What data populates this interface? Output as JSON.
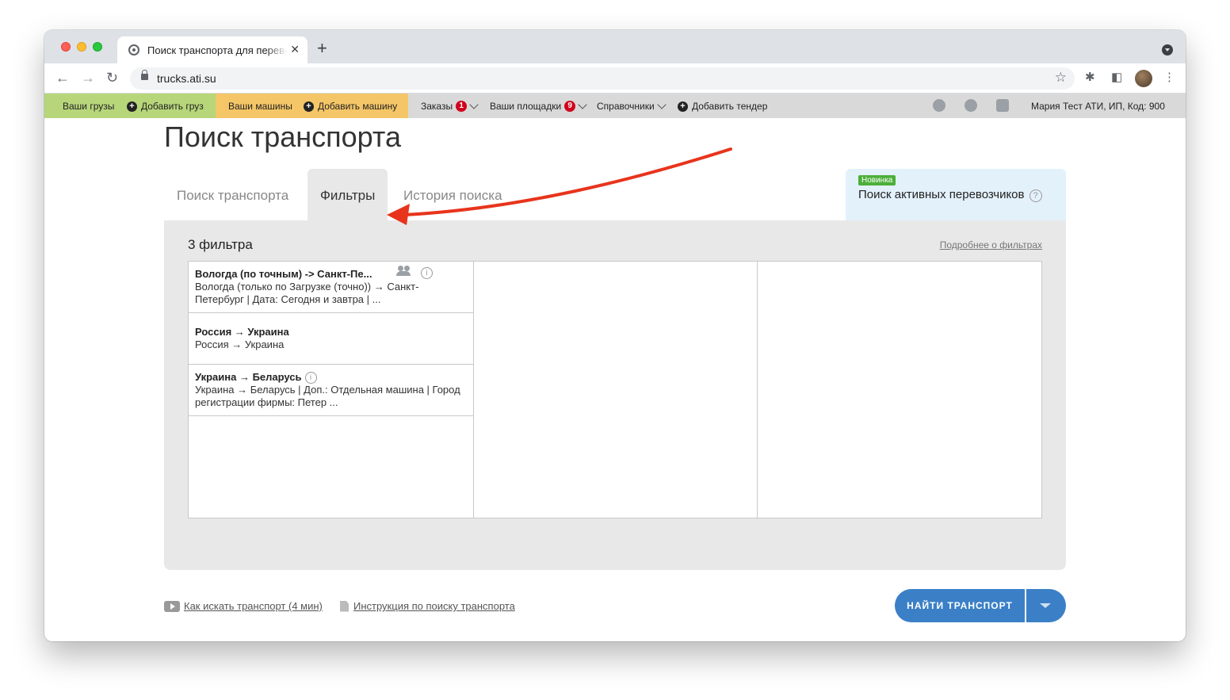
{
  "browser": {
    "tab_title": "Поиск транспорта для перевозки",
    "url": "trucks.ati.su"
  },
  "sitenav": {
    "your_cargo": "Ваши грузы",
    "add_cargo": "Добавить груз",
    "your_trucks": "Ваши машины",
    "add_truck": "Добавить машину",
    "orders": "Заказы",
    "orders_badge": "1",
    "platforms": "Ваши площадки",
    "platforms_badge": "9",
    "references": "Справочники",
    "add_tender": "Добавить тендер",
    "user": "Мария Тест АТИ, ИП,  Код: 900"
  },
  "page": {
    "title": "Поиск транспорта",
    "tabs": [
      {
        "label": "Поиск транспорта"
      },
      {
        "label": "Фильтры"
      },
      {
        "label": "История поиска"
      }
    ],
    "promo_badge": "Новинка",
    "promo_text": "Поиск активных перевозчиков"
  },
  "filters": {
    "count_label": "3 фильтра",
    "more_link": "Подробнее о фильтрах",
    "items": [
      {
        "name": "Вологда (по точным) -> Санкт-Пе...",
        "desc": "Вологда (только по Загрузке (точно)) → Санкт-Петербург | Дата: Сегодня и завтра | ..."
      },
      {
        "name": "Россия → Украина",
        "desc": "Россия → Украина"
      },
      {
        "name": "Украина → Беларусь",
        "desc": "Украина → Беларусь | Доп.: Отдельная машина | Город регистрации фирмы: Петер ..."
      }
    ]
  },
  "footer": {
    "video_link": "Как искать транспорт (4 мин)",
    "doc_link": "Инструкция по поиску транспорта",
    "find_button": "НАЙТИ ТРАНСПОРТ"
  },
  "colors": {
    "accent_blue": "#3b80c7",
    "annotation_arrow": "#e8341c",
    "green_bar": "#b7d67a",
    "yellow_bar": "#f5c667"
  }
}
